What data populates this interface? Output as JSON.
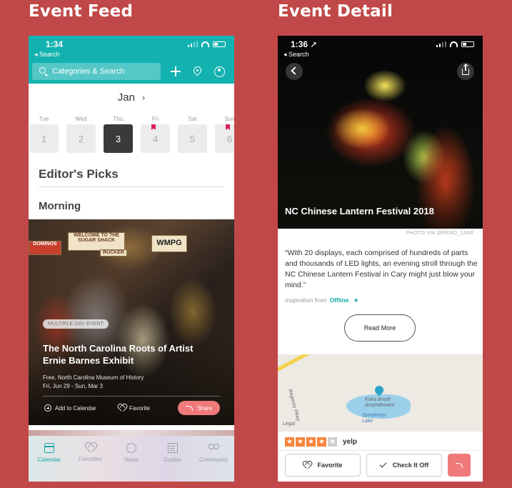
{
  "titles": {
    "feed": "Event Feed",
    "detail": "Event Detail"
  },
  "feed": {
    "status": {
      "time": "1:34",
      "back": "◂ Search"
    },
    "search_placeholder": "Categories & Search",
    "month": "Jan",
    "month_next_icon": "chevron-right-icon",
    "days": [
      {
        "name": "Tue",
        "num": "1"
      },
      {
        "name": "Wed",
        "num": "2"
      },
      {
        "name": "Thu",
        "num": "3"
      },
      {
        "name": "Fri",
        "num": "4"
      },
      {
        "name": "Sat",
        "num": "5"
      },
      {
        "name": "Sun",
        "num": "6"
      }
    ],
    "editors_picks": "Editor's Picks",
    "morning": "Morning",
    "event": {
      "badge": "MULTIPLE DAY EVENT",
      "title": "The North Carolina Roots of Artist Ernie Barnes Exhibit",
      "venue": "Free, North Carolina Museum of History",
      "dates": "Fri, Jun 29 - Sun, Mar 3",
      "add_to_calendar": "Add to Calendar",
      "favorite": "Favorite",
      "share": "Share",
      "signs": {
        "shack": "WELCOME TO THE SUGAR SHACK",
        "wmpg": "WMPG",
        "rucker": "RUCKER",
        "domino": "DOMINOS"
      }
    },
    "tabs": [
      {
        "label": "Calendar"
      },
      {
        "label": "Favorites"
      },
      {
        "label": "News"
      },
      {
        "label": "Guides"
      },
      {
        "label": "Community"
      }
    ]
  },
  "detail": {
    "status": {
      "time": "1:36 ➚",
      "back": "◂ Search"
    },
    "title": "NC Chinese Lantern Festival 2018",
    "photo_credit": "PHOTO VIA @RENO_1ANE",
    "quote": "“With 20 displays, each comprised of hundreds of parts and thousands of LED lights, an evening stroll through the NC Chinese Lantern Festival in Cary might just blow your mind.”",
    "inspiration_label": "Inspiration from",
    "inspiration_source": "Offline",
    "read_more": "Read More",
    "map_labels": {
      "amphitheatre": "Koka Booth Amphitheatre",
      "lake": "Symphony Lake",
      "legal": "Legal",
      "road": "Regency Pkwy"
    },
    "rating": {
      "stars": 4,
      "of": 5,
      "source": "yelp"
    },
    "favorite": "Favorite",
    "check_it_off": "Check It Off"
  },
  "colors": {
    "background": "#c14848",
    "teal": "#13b2b0",
    "share_red": "#f07a7a",
    "marker_pink": "#d8225a"
  }
}
